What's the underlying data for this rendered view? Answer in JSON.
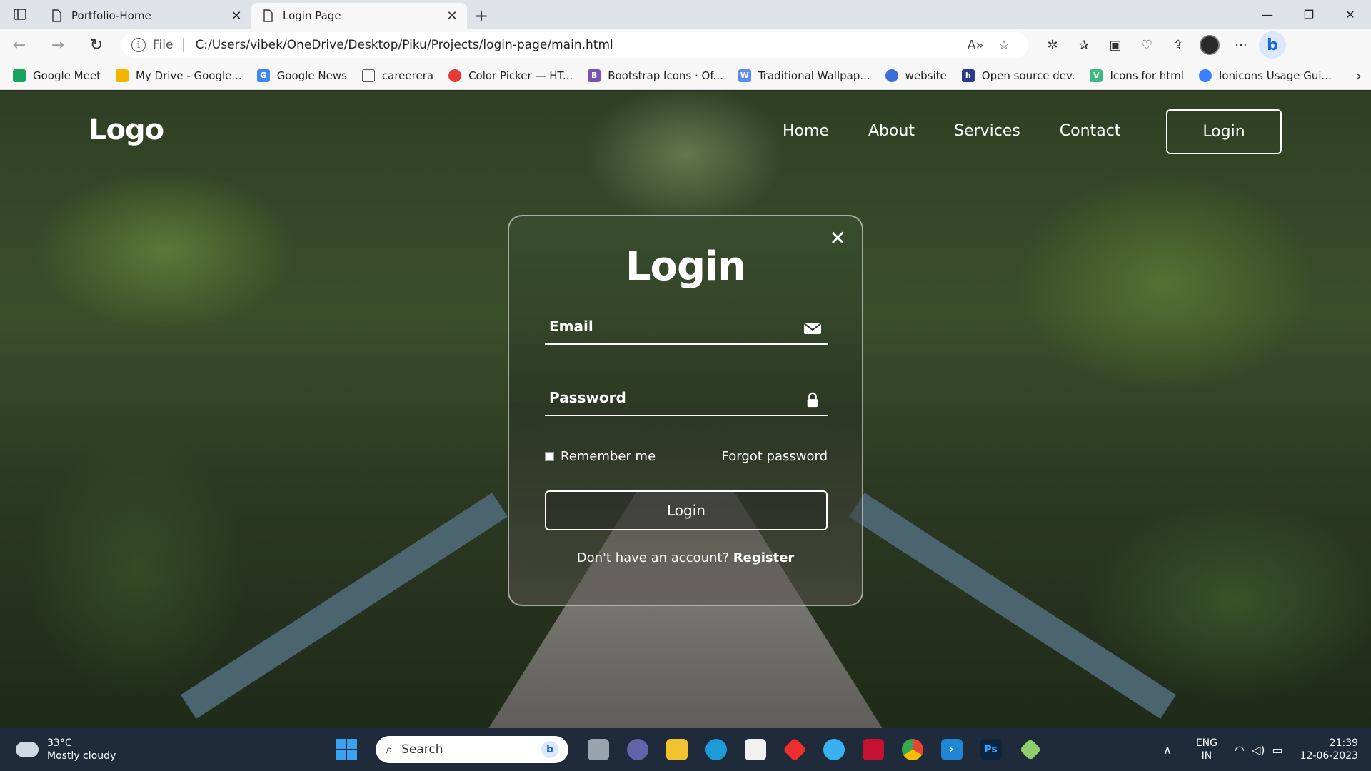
{
  "browser": {
    "tabs": [
      {
        "title": "Portfolio-Home",
        "active": false
      },
      {
        "title": "Login Page",
        "active": true
      }
    ],
    "address": {
      "scheme": "File",
      "url": "C:/Users/vibek/OneDrive/Desktop/Piku/Projects/login-page/main.html"
    },
    "bookmarks": [
      {
        "label": "Google Meet",
        "icon": "meet-icon",
        "color": "#1aa260"
      },
      {
        "label": "My Drive - Google...",
        "icon": "drive-icon",
        "color": "#f4b400"
      },
      {
        "label": "Google News",
        "icon": "news-icon",
        "color": "#4285f4"
      },
      {
        "label": "careerera",
        "icon": "page-icon",
        "color": "#888888"
      },
      {
        "label": "Color Picker — HT...",
        "icon": "colorpicker-icon",
        "color": "#e53935"
      },
      {
        "label": "Bootstrap Icons · Of...",
        "icon": "bootstrap-icon",
        "color": "#7952b3"
      },
      {
        "label": "Traditional Wallpap...",
        "icon": "wallpaper-icon",
        "color": "#5b8def"
      },
      {
        "label": "website",
        "icon": "website-icon",
        "color": "#3a6fd8"
      },
      {
        "label": "Open source dev.",
        "icon": "hashnode-icon",
        "color": "#2b3a8f"
      },
      {
        "label": "Icons for html",
        "icon": "vue-icon",
        "color": "#41b883"
      },
      {
        "label": "Ionicons Usage Gui...",
        "icon": "ionicons-icon",
        "color": "#3880ff"
      }
    ]
  },
  "site": {
    "logo": "Logo",
    "nav": [
      "Home",
      "About",
      "Services",
      "Contact"
    ],
    "login_button": "Login"
  },
  "form": {
    "title": "Login",
    "email_label": "Email",
    "password_label": "Password",
    "remember": "Remember me",
    "forgot": "Forgot password",
    "submit": "Login",
    "no_account": "Don't have an account?",
    "register": "Register"
  },
  "taskbar": {
    "temp": "33°C",
    "weather": "Mostly cloudy",
    "search_placeholder": "Search",
    "lang_top": "ENG",
    "lang_bottom": "IN",
    "time": "21:39",
    "date": "12-06-2023"
  }
}
